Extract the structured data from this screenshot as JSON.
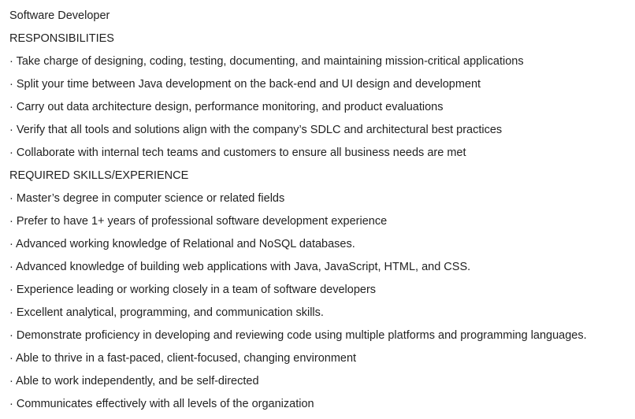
{
  "document": {
    "title": "Software Developer",
    "sections": [
      {
        "heading": "RESPONSIBILITIES",
        "items": [
          "· Take charge of designing, coding, testing, documenting, and maintaining mission-critical applications",
          "· Split your time between Java development on the back-end and UI design and development",
          "· Carry out data architecture design, performance monitoring, and product evaluations",
          "· Verify that all tools and solutions align with the company’s SDLC and architectural best practices",
          "· Collaborate with internal tech teams and customers to ensure all business needs are met"
        ]
      },
      {
        "heading": "REQUIRED SKILLS/EXPERIENCE",
        "items": [
          "· Master’s degree in computer science or related fields",
          "· Prefer to have 1+ years of professional software development experience",
          "· Advanced working knowledge of Relational and NoSQL databases.",
          "· Advanced knowledge of building web applications with Java, JavaScript, HTML, and CSS.",
          "· Experience leading or working closely in a team of software developers",
          "· Excellent analytical, programming, and communication skills.",
          "· Demonstrate proficiency in developing and reviewing code using multiple platforms and programming languages.",
          "· Able to thrive in a fast-paced, client-focused, changing environment",
          "· Able to work independently, and be self-directed",
          "· Communicates effectively with all levels of the organization"
        ]
      }
    ]
  }
}
